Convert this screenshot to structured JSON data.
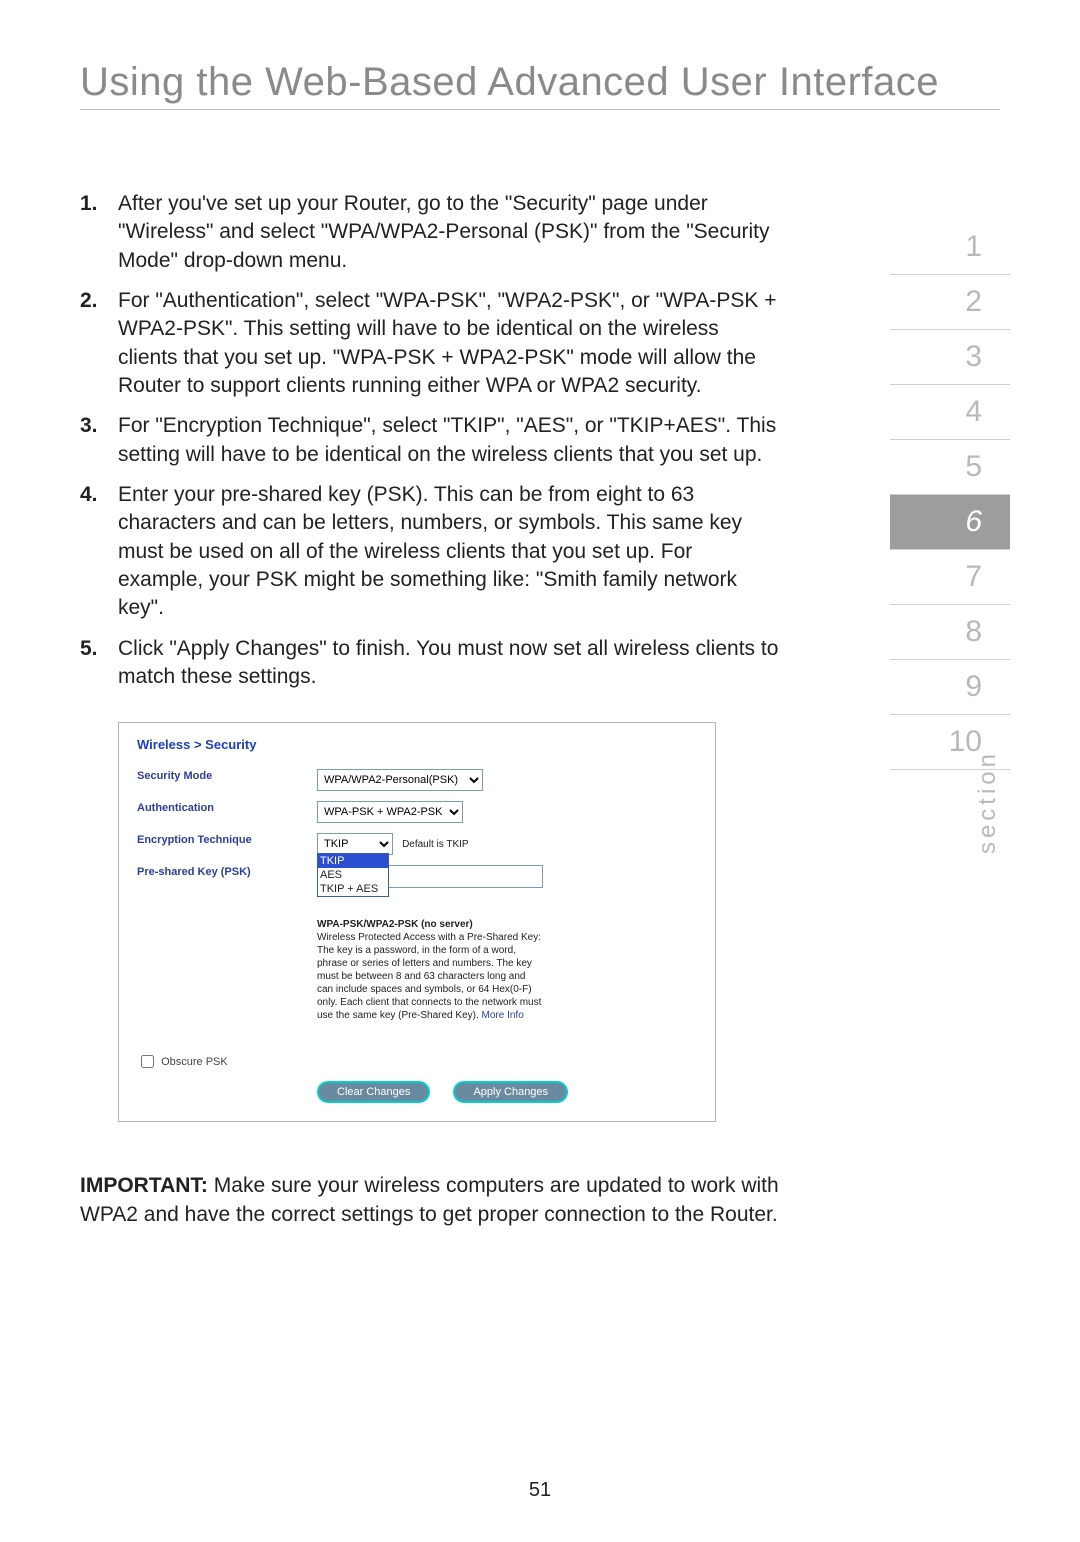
{
  "title": "Using the Web-Based Advanced User Interface",
  "section_label": "section",
  "page_number": "51",
  "section_nav": {
    "active_index": 5,
    "items": [
      "1",
      "2",
      "3",
      "4",
      "5",
      "6",
      "7",
      "8",
      "9",
      "10"
    ]
  },
  "steps": [
    {
      "n": "1.",
      "text": "After you've set up your Router, go to the \"Security\" page under \"Wireless\" and select \"WPA/WPA2-Personal (PSK)\" from the \"Security Mode\" drop-down menu."
    },
    {
      "n": "2.",
      "text": "For \"Authentication\", select \"WPA-PSK\", \"WPA2-PSK\", or \"WPA-PSK + WPA2-PSK\". This setting will have to be identical on the wireless clients that you set up. \"WPA-PSK + WPA2-PSK\" mode will allow the Router to support clients running either WPA or WPA2 security."
    },
    {
      "n": "3.",
      "text": "For \"Encryption Technique\", select \"TKIP\",  \"AES\", or \"TKIP+AES\". This setting will have to be identical on the wireless clients that you set up."
    },
    {
      "n": "4.",
      "text": "Enter your pre-shared key (PSK). This can be from eight to 63 characters and can be letters, numbers, or symbols. This same key must be used on all of the wireless clients that you set up. For example, your PSK might be something like: \"Smith family network key\"."
    },
    {
      "n": "5.",
      "text": "Click \"Apply Changes\" to finish. You must now set all wireless clients to match these settings."
    }
  ],
  "router_ui": {
    "breadcrumb": "Wireless > Security",
    "labels": {
      "security_mode": "Security Mode",
      "authentication": "Authentication",
      "encryption": "Encryption Technique",
      "psk": "Pre-shared Key (PSK)",
      "obscure": "Obscure PSK"
    },
    "security_mode": {
      "value": "WPA/WPA2-Personal(PSK)"
    },
    "authentication": {
      "value": "WPA-PSK + WPA2-PSK"
    },
    "encryption": {
      "value": "TKIP",
      "default_note": "Default is TKIP",
      "options": [
        "TKIP",
        "AES",
        "TKIP + AES"
      ],
      "selected_option_index": 0
    },
    "psk": {
      "value": "",
      "heading": "WPA-PSK/WPA2-PSK (no server)",
      "description": "Wireless Protected Access with a Pre-Shared Key: The key is a password, in the form of a word, phrase or series of letters and numbers. The key must be between 8 and 63 characters long and can include spaces and symbols, or 64 Hex(0-F) only. Each client that connects to the network must use the same key (Pre-Shared Key).",
      "more_info": "More Info"
    },
    "obscure_checked": false,
    "buttons": {
      "clear": "Clear Changes",
      "apply": "Apply Changes"
    }
  },
  "important": {
    "label": "IMPORTANT:",
    "text": " Make sure your wireless computers are updated to work with WPA2 and have the correct settings to get proper connection to the Router."
  }
}
